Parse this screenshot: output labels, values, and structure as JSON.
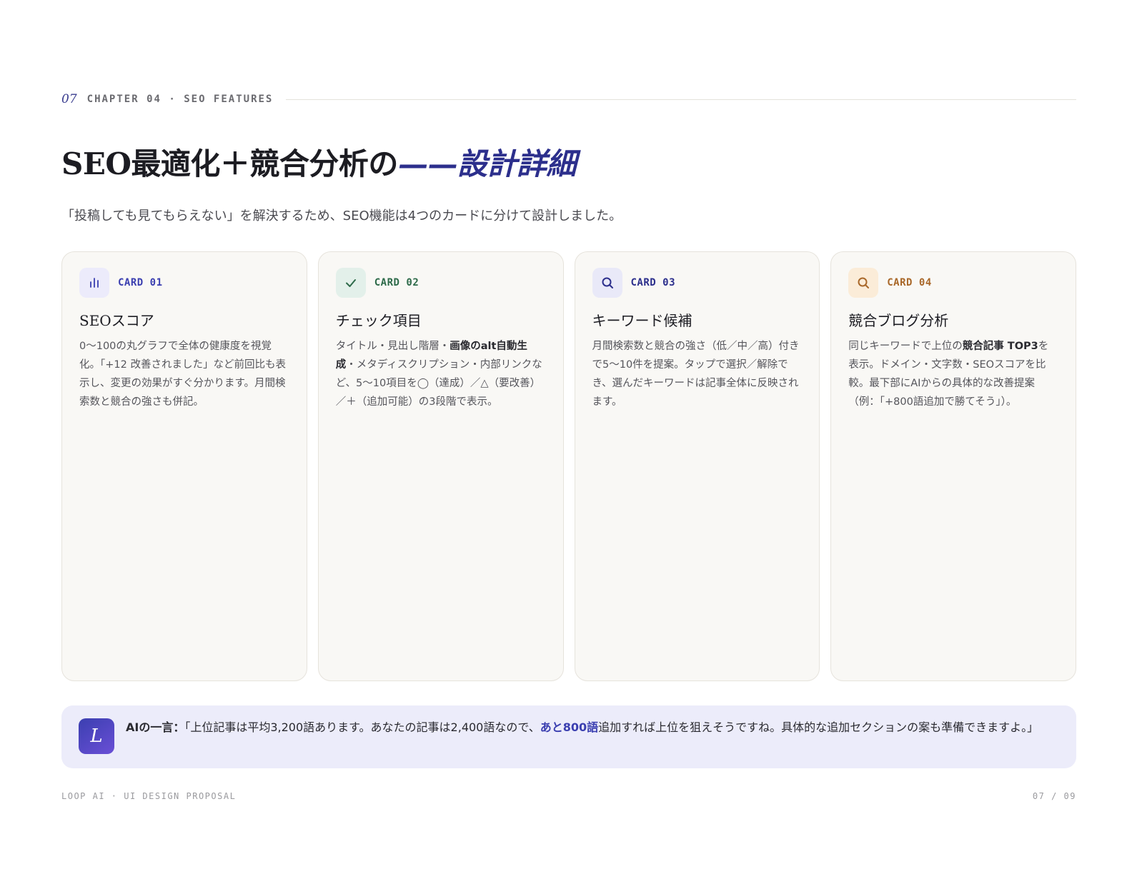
{
  "header": {
    "page_number": "07",
    "chapter_label": "CHAPTER 04 · SEO FEATURES"
  },
  "title": {
    "main": "SEO最適化＋競合分析の",
    "dash": "——",
    "accent": "設計詳細"
  },
  "lead": "「投稿しても見てもらえない」を解決するため、SEO機能は4つのカードに分けて設計しました。",
  "cards": [
    {
      "tag": "CARD 01",
      "icon": "bar-chart-icon",
      "title": "SEOスコア",
      "body": "0〜100の丸グラフで全体の健康度を視覚化。「+12 改善されました」など前回比も表示し、変更の効果がすぐ分かります。月間検索数と競合の強さも併記。"
    },
    {
      "tag": "CARD 02",
      "icon": "check-icon",
      "title": "チェック項目",
      "body_pre": "タイトル・見出し階層・",
      "body_bold": "画像のalt自動生成",
      "body_post": "・メタディスクリプション・内部リンクなど、5〜10項目を◯（達成）／△（要改善）／＋（追加可能）の3段階で表示。"
    },
    {
      "tag": "CARD 03",
      "icon": "search-icon",
      "title": "キーワード候補",
      "body": "月間検索数と競合の強さ（低／中／高）付きで5〜10件を提案。タップで選択／解除でき、選んだキーワードは記事全体に反映されます。"
    },
    {
      "tag": "CARD 04",
      "icon": "search-icon",
      "title": "競合ブログ分析",
      "body_pre": "同じキーワードで上位の",
      "body_bold": "競合記事 TOP3",
      "body_post": "を表示。ドメイン・文字数・SEOスコアを比較。最下部にAIからの具体的な改善提案（例：「+800語追加で勝てそう」）。"
    }
  ],
  "ai_note": {
    "avatar_letter": "L",
    "label": "AIの一言：",
    "text_pre": "「上位記事は平均3,200語あります。あなたの記事は2,400語なので、",
    "text_highlight": "あと800語",
    "text_post": "追加すれば上位を狙えそうですね。具体的な追加セクションの案も準備できますよ。」"
  },
  "footer": {
    "left": "LOOP AI · UI DESIGN PROPOSAL",
    "right": "07 / 09"
  },
  "colors": {
    "accent": "#2c2f8c",
    "card_bg": "#f9f8f5",
    "ai_box_bg": "#ececfa",
    "card1_tag": "#3b3fb0",
    "card2_tag": "#2e6b4a",
    "card3_tag": "#2c2f8c",
    "card4_tag": "#a9682a"
  }
}
